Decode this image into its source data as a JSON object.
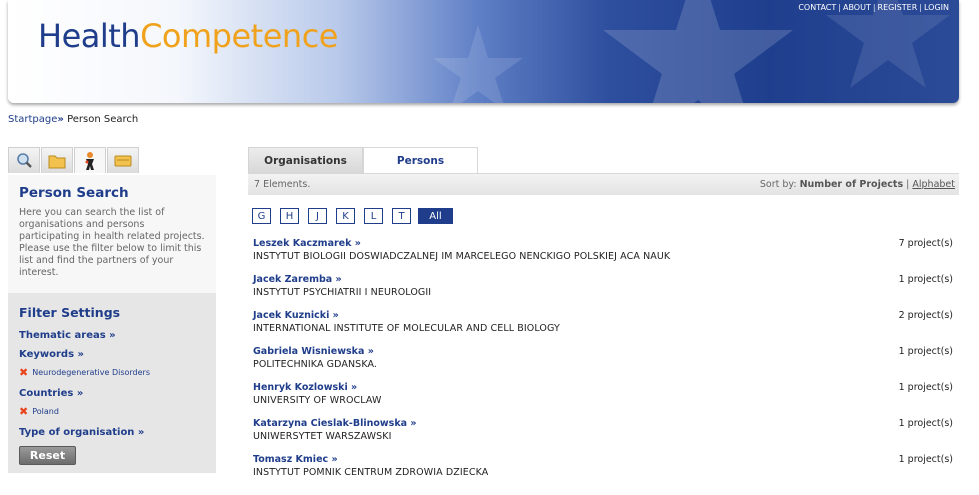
{
  "header": {
    "logo_part1": "Health",
    "logo_part2": "Competence",
    "links": [
      "CONTACT",
      "ABOUT",
      "REGISTER",
      "LOGIN"
    ],
    "colors": {
      "brand_blue": "#1f3d8a",
      "brand_orange": "#f0a21c"
    }
  },
  "breadcrumb": {
    "home": "Startpage",
    "separator": "»",
    "current": "Person Search"
  },
  "sidebar": {
    "tabs": [
      {
        "icon": "search-icon"
      },
      {
        "icon": "folder-icon"
      },
      {
        "icon": "person-icon",
        "active": true
      },
      {
        "icon": "card-icon"
      }
    ],
    "title": "Person Search",
    "description": "Here you can search the list of organisations and persons participating in health related projects. Please use the filter below to limit this list and find the partners of your interest.",
    "filter_title": "Filter Settings",
    "filters": [
      {
        "label": "Thematic areas",
        "arrow": "»"
      },
      {
        "label": "Keywords",
        "arrow": "»",
        "selected": "Neurodegenerative Disorders"
      },
      {
        "label": "Countries",
        "arrow": "»",
        "selected": "Poland"
      },
      {
        "label": "Type of organisation",
        "arrow": "»"
      }
    ],
    "remove_icon": "✖",
    "reset_label": "Reset"
  },
  "main": {
    "tabs": [
      {
        "label": "Organisations",
        "active": false
      },
      {
        "label": "Persons",
        "active": true
      }
    ],
    "count_text": "7 Elements.",
    "sort_label": "Sort by:",
    "sort_active": "Number of Projects",
    "sort_sep": "|",
    "sort_other": "Alphabet",
    "letters": [
      "G",
      "H",
      "J",
      "K",
      "L",
      "T"
    ],
    "all_label": "All",
    "arrow": "»",
    "persons": [
      {
        "name": "Leszek Kaczmarek",
        "org": "INSTYTUT BIOLOGII DOSWIADCZALNEJ IM MARCELEGO NENCKIGO POLSKIEJ ACA NAUK",
        "projects": "7 project(s)"
      },
      {
        "name": "Jacek Zaremba",
        "org": "INSTYTUT PSYCHIATRII I NEUROLOGII",
        "projects": "1 project(s)"
      },
      {
        "name": "Jacek Kuznicki",
        "org": "INTERNATIONAL INSTITUTE OF MOLECULAR AND CELL BIOLOGY",
        "projects": "2 project(s)"
      },
      {
        "name": "Gabriela Wisniewska",
        "org": "POLITECHNIKA GDANSKA.",
        "projects": "1 project(s)"
      },
      {
        "name": "Henryk Kozlowski",
        "org": "UNIVERSITY OF WROCLAW",
        "projects": "1 project(s)"
      },
      {
        "name": "Katarzyna Cieslak-Blinowska",
        "org": "UNIWERSYTET WARSZAWSKI",
        "projects": "1 project(s)"
      },
      {
        "name": "Tomasz Kmiec",
        "org": "INSTYTUT POMNIK CENTRUM ZDROWIA DZIECKA",
        "projects": "1 project(s)"
      }
    ]
  }
}
